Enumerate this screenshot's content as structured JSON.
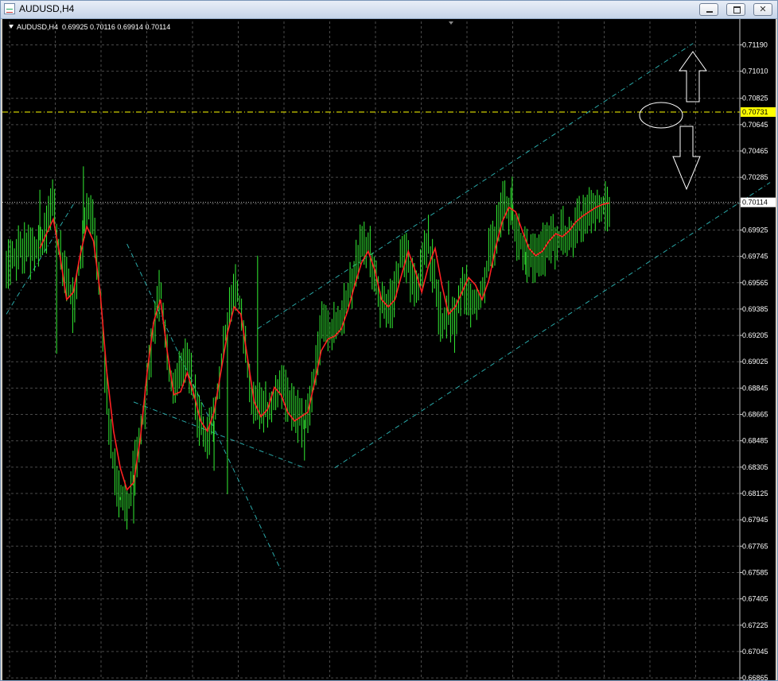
{
  "window": {
    "title": "AUDUSD,H4",
    "controls": [
      "minimize-icon",
      "maximize-icon",
      "close-icon"
    ]
  },
  "symbol_info": "AUDUSD,H4  0.69925 0.70116 0.69914 0.70114",
  "colors": {
    "background": "#000000",
    "grid": "#4a4a4a",
    "price_bars": "#33ee33",
    "moving_average": "#ff2222",
    "channels": "#2aa9a9",
    "axis_text": "#ffffff",
    "level_line": "#ffff00",
    "current_price_line": "#bbbbbb",
    "annotations": "#ffffff"
  },
  "chart_data": {
    "type": "line",
    "y_ticks": [
      "0.71190",
      "0.71010",
      "0.70825",
      "0.70645",
      "0.70465",
      "0.70285",
      "0.70105",
      "0.69925",
      "0.69745",
      "0.69565",
      "0.69385",
      "0.69205",
      "0.69025",
      "0.68845",
      "0.68665",
      "0.68485",
      "0.68305",
      "0.68125",
      "0.67945",
      "0.67765",
      "0.67585",
      "0.67405",
      "0.67225",
      "0.67045",
      "0.66865"
    ],
    "ylim": [
      0.6686,
      0.7135
    ],
    "grid": true,
    "x_range": [
      0,
      180
    ],
    "horizontal_level": {
      "value": 0.70731,
      "label": "0.70731"
    },
    "current_price": {
      "value": 0.70114,
      "label": "0.70114"
    },
    "price_path_x": [
      0,
      4,
      8,
      12,
      14,
      16,
      20,
      22,
      24,
      26,
      28,
      30,
      32,
      34,
      36,
      40,
      44,
      46,
      48,
      50,
      52,
      54,
      56,
      58,
      60,
      62,
      64,
      66,
      68,
      70,
      72,
      74,
      78,
      82,
      86,
      90,
      94,
      96,
      98,
      100,
      102,
      104,
      106,
      108,
      112,
      116,
      118,
      122,
      126,
      130,
      132,
      134,
      136,
      138,
      140,
      142,
      144,
      146,
      148,
      150,
      152,
      154,
      156,
      160,
      164,
      166,
      168,
      170,
      172,
      174,
      176,
      178,
      180
    ],
    "price_path_y": [
      0.6965,
      0.6982,
      0.6977,
      0.6994,
      0.701,
      0.6975,
      0.694,
      0.6972,
      0.7008,
      0.6995,
      0.695,
      0.688,
      0.683,
      0.681,
      0.68,
      0.685,
      0.6925,
      0.6955,
      0.6905,
      0.6875,
      0.6898,
      0.6905,
      0.688,
      0.6858,
      0.685,
      0.6862,
      0.69,
      0.693,
      0.6955,
      0.694,
      0.69,
      0.6868,
      0.687,
      0.6887,
      0.6865,
      0.6862,
      0.6925,
      0.692,
      0.6925,
      0.6935,
      0.6948,
      0.6965,
      0.698,
      0.6985,
      0.694,
      0.6945,
      0.6985,
      0.695,
      0.6985,
      0.6925,
      0.6938,
      0.6925,
      0.696,
      0.6945,
      0.694,
      0.695,
      0.6975,
      0.6988,
      0.701,
      0.7008,
      0.699,
      0.6985,
      0.697,
      0.6978,
      0.6985,
      0.699,
      0.6985,
      0.6995,
      0.7,
      0.7005,
      0.7008,
      0.701,
      0.7011
    ],
    "moving_average_x": [
      10,
      12,
      14,
      16,
      18,
      20,
      22,
      24,
      26,
      28,
      30,
      32,
      34,
      36,
      38,
      40,
      42,
      44,
      46,
      48,
      50,
      52,
      54,
      56,
      58,
      60,
      62,
      64,
      66,
      68,
      70,
      72,
      74,
      76,
      78,
      80,
      82,
      84,
      86,
      88,
      90,
      92,
      94,
      96,
      98,
      100,
      102,
      104,
      106,
      108,
      110,
      112,
      114,
      116,
      118,
      120,
      122,
      124,
      126,
      128,
      130,
      132,
      134,
      136,
      138,
      140,
      142,
      144,
      146,
      148,
      150,
      152,
      154,
      156,
      158,
      160,
      162,
      164,
      166,
      168,
      170,
      172,
      174,
      176,
      178,
      180
    ],
    "moving_average_y": [
      0.698,
      0.699,
      0.7,
      0.6975,
      0.6945,
      0.695,
      0.6975,
      0.6995,
      0.6985,
      0.695,
      0.6895,
      0.6855,
      0.683,
      0.6815,
      0.682,
      0.685,
      0.6895,
      0.693,
      0.6945,
      0.691,
      0.688,
      0.6882,
      0.6895,
      0.688,
      0.6862,
      0.6855,
      0.6868,
      0.6895,
      0.6922,
      0.694,
      0.6935,
      0.6905,
      0.6875,
      0.6865,
      0.687,
      0.6885,
      0.688,
      0.6868,
      0.6862,
      0.6865,
      0.6868,
      0.6888,
      0.691,
      0.6918,
      0.692,
      0.6925,
      0.6938,
      0.6955,
      0.697,
      0.6978,
      0.6965,
      0.6945,
      0.694,
      0.6945,
      0.6962,
      0.6978,
      0.6965,
      0.695,
      0.6968,
      0.698,
      0.6955,
      0.6935,
      0.694,
      0.695,
      0.696,
      0.6955,
      0.6945,
      0.6958,
      0.698,
      0.6998,
      0.7008,
      0.7005,
      0.6992,
      0.698,
      0.6975,
      0.6978,
      0.6985,
      0.699,
      0.6988,
      0.6992,
      0.6998,
      0.7002,
      0.7005,
      0.7008,
      0.701,
      0.7011
    ],
    "channel_lines": [
      {
        "x": [
          0,
          20
        ],
        "y": [
          0.6935,
          0.701
        ]
      },
      {
        "x": [
          75,
          205
        ],
        "y": [
          0.6925,
          0.712
        ]
      },
      {
        "x": [
          98,
          228
        ],
        "y": [
          0.683,
          0.7025
        ]
      },
      {
        "x": [
          36,
          82
        ],
        "y": [
          0.6983,
          0.676
        ]
      },
      {
        "x": [
          38,
          89
        ],
        "y": [
          0.6875,
          0.683
        ]
      }
    ]
  }
}
